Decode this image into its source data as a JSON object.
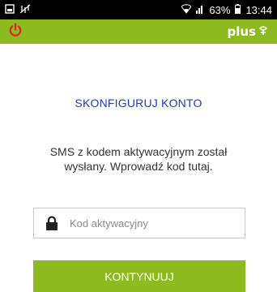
{
  "status_bar": {
    "battery": "63%",
    "time": "13:44"
  },
  "app_bar": {
    "brand": "plus"
  },
  "main": {
    "title": "SKONFIGURUJ KONTO",
    "message": "SMS z kodem aktywacyjnym został wysłany. Wprowadź kod tutaj.",
    "code_field": {
      "placeholder": "Kod aktywacyjny",
      "value": ""
    },
    "continue_label": "KONTYNUUJ"
  },
  "colors": {
    "brand_green": "#8dba1f",
    "title_blue": "#1a3cc6",
    "power_red": "#e0251b"
  },
  "icons": [
    "notification-icon",
    "sync-off-icon",
    "wifi-icon",
    "signal-icon",
    "battery-icon",
    "power-icon",
    "plus-logo-icon",
    "lock-icon"
  ]
}
